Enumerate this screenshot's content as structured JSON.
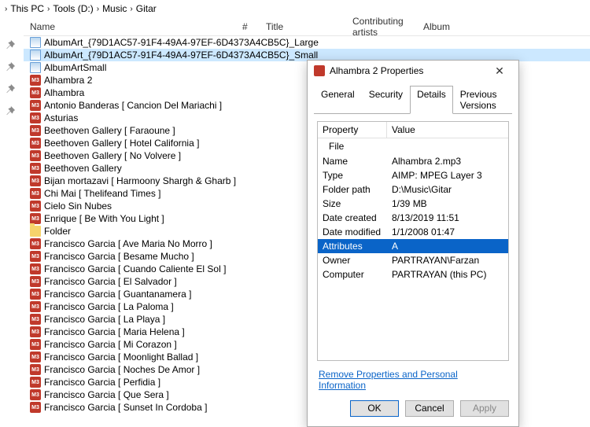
{
  "breadcrumb": [
    "This PC",
    "Tools (D:)",
    "Music",
    "Gitar"
  ],
  "columns": {
    "name": "Name",
    "num": "#",
    "title": "Title",
    "artist": "Contributing artists",
    "album": "Album"
  },
  "files": [
    {
      "icon": "img",
      "name": "AlbumArt_{79D1AC57-91F4-49A4-97EF-6D4373A4CB5C}_Large",
      "selected": false
    },
    {
      "icon": "img",
      "name": "AlbumArt_{79D1AC57-91F4-49A4-97EF-6D4373A4CB5C}_Small",
      "selected": true
    },
    {
      "icon": "img",
      "name": "AlbumArtSmall"
    },
    {
      "icon": "mp3",
      "name": "Alhambra 2"
    },
    {
      "icon": "mp3",
      "name": "Alhambra"
    },
    {
      "icon": "mp3",
      "name": "Antonio Banderas [ Cancion Del Mariachi ]"
    },
    {
      "icon": "mp3",
      "name": "Asturias"
    },
    {
      "icon": "mp3",
      "name": "Beethoven Gallery [ Faraoune ]"
    },
    {
      "icon": "mp3",
      "name": "Beethoven Gallery [ Hotel California ]"
    },
    {
      "icon": "mp3",
      "name": "Beethoven Gallery [ No Volvere ]"
    },
    {
      "icon": "mp3",
      "name": "Beethoven Gallery"
    },
    {
      "icon": "mp3",
      "name": "Bijan mortazavi [ Harmoony Shargh & Gharb ]"
    },
    {
      "icon": "mp3",
      "name": "Chi Mai [ Thelifeand Times ]"
    },
    {
      "icon": "mp3",
      "name": "Cielo Sin Nubes"
    },
    {
      "icon": "mp3",
      "name": "Enrique [ Be With You  Light ]"
    },
    {
      "icon": "folder",
      "name": "Folder"
    },
    {
      "icon": "mp3",
      "name": "Francisco Garcia [ Ave Maria No Morro ]"
    },
    {
      "icon": "mp3",
      "name": "Francisco Garcia [ Besame Mucho ]"
    },
    {
      "icon": "mp3",
      "name": "Francisco Garcia [ Cuando Caliente El Sol ]"
    },
    {
      "icon": "mp3",
      "name": "Francisco Garcia [ El Salvador ]"
    },
    {
      "icon": "mp3",
      "name": "Francisco Garcia [ Guantanamera ]"
    },
    {
      "icon": "mp3",
      "name": "Francisco Garcia [ La Paloma ]"
    },
    {
      "icon": "mp3",
      "name": "Francisco Garcia [ La Playa ]"
    },
    {
      "icon": "mp3",
      "name": "Francisco Garcia [ Maria Helena ]"
    },
    {
      "icon": "mp3",
      "name": "Francisco Garcia [ Mi Corazon ]"
    },
    {
      "icon": "mp3",
      "name": "Francisco Garcia [ Moonlight Ballad ]"
    },
    {
      "icon": "mp3",
      "name": "Francisco Garcia [ Noches De Amor ]"
    },
    {
      "icon": "mp3",
      "name": "Francisco Garcia [ Perfidia ]"
    },
    {
      "icon": "mp3",
      "name": "Francisco Garcia [ Que Sera ]"
    },
    {
      "icon": "mp3",
      "name": "Francisco Garcia [ Sunset In Cordoba ]"
    }
  ],
  "dialog": {
    "title": "Alhambra 2 Properties",
    "tabs": {
      "general": "General",
      "security": "Security",
      "details": "Details",
      "previous": "Previous Versions"
    },
    "detail_hdr": {
      "property": "Property",
      "value": "Value"
    },
    "group": "File",
    "rows": [
      {
        "p": "Name",
        "v": "Alhambra 2.mp3"
      },
      {
        "p": "Type",
        "v": "AIMP: MPEG Layer 3"
      },
      {
        "p": "Folder path",
        "v": "D:\\Music\\Gitar"
      },
      {
        "p": "Size",
        "v": "1/39 MB"
      },
      {
        "p": "Date created",
        "v": "8/13/2019 11:51"
      },
      {
        "p": "Date modified",
        "v": "1/1/2008 01:47"
      },
      {
        "p": "Attributes",
        "v": "A",
        "selected": true
      },
      {
        "p": "Owner",
        "v": "PARTRAYAN\\Farzan"
      },
      {
        "p": "Computer",
        "v": "PARTRAYAN (this PC)"
      }
    ],
    "link": "Remove Properties and Personal Information",
    "buttons": {
      "ok": "OK",
      "cancel": "Cancel",
      "apply": "Apply"
    }
  }
}
